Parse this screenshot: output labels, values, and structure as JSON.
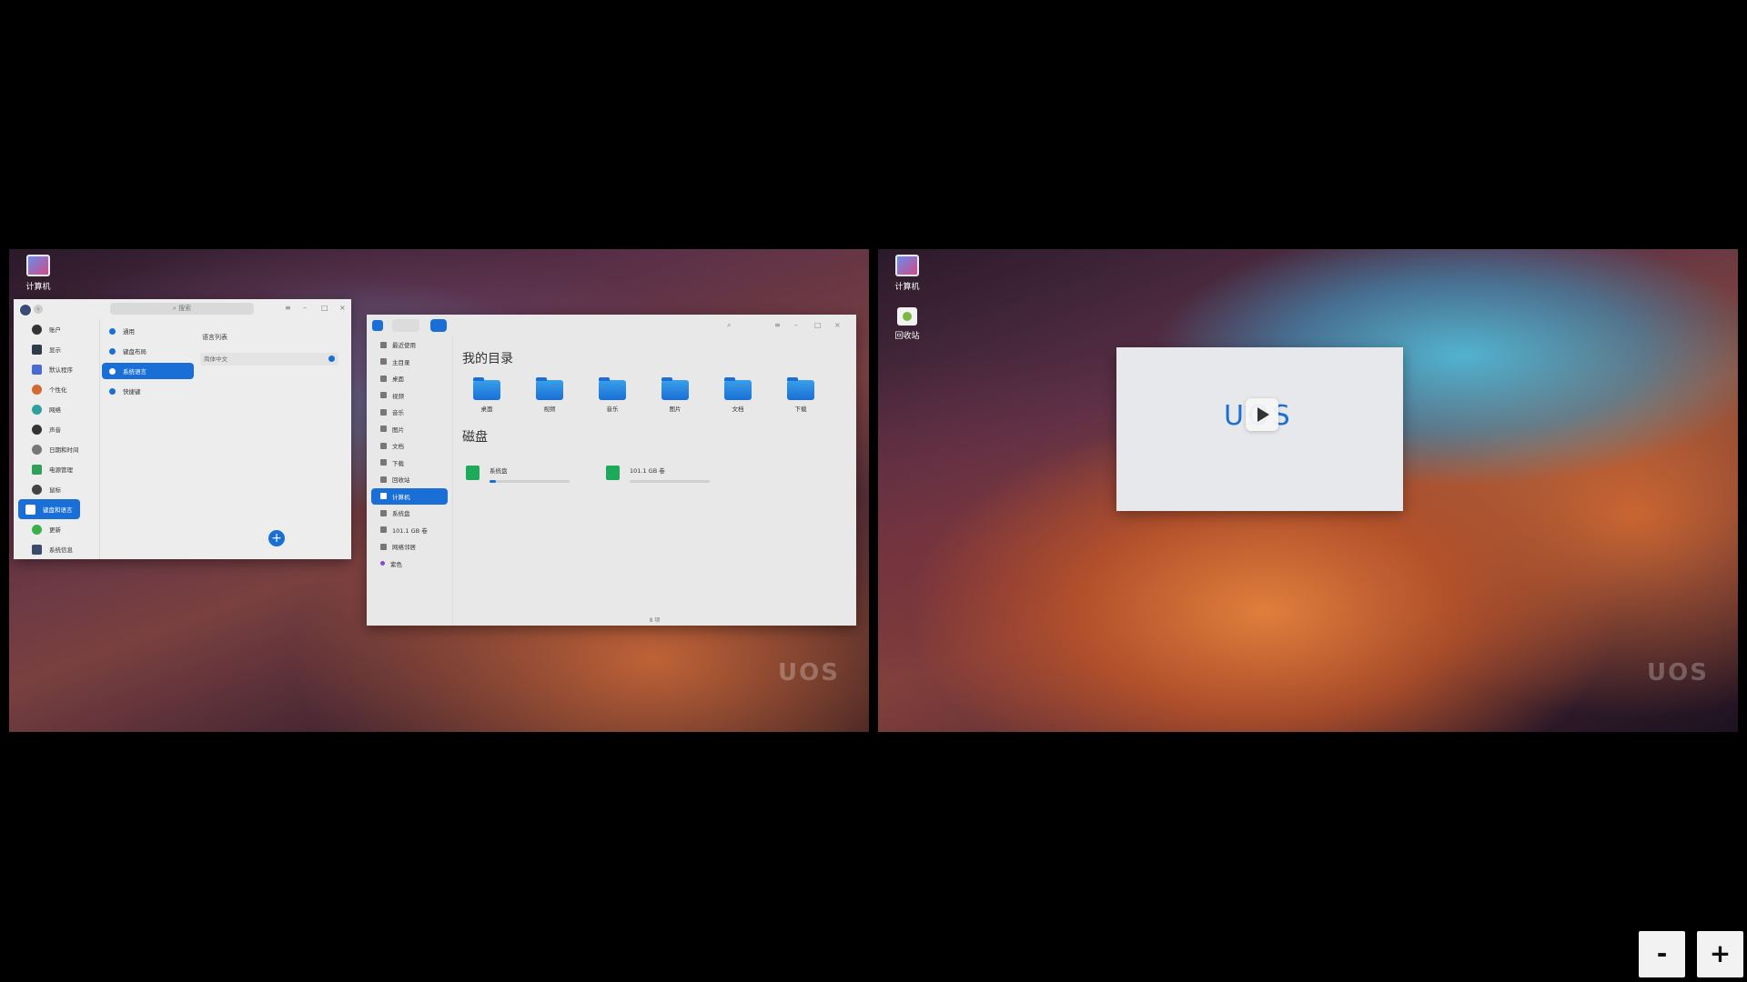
{
  "left_desktop": {
    "icons": [
      {
        "label": "计算机",
        "icon": "computer-icon"
      }
    ],
    "watermark": "UOS"
  },
  "settings_window": {
    "search_placeholder": "搜索",
    "sidebar": [
      {
        "label": "账户",
        "color": "#333333"
      },
      {
        "label": "显示",
        "color": "#2e3b4a"
      },
      {
        "label": "默认程序",
        "color": "#4a6ad0"
      },
      {
        "label": "个性化",
        "color": "#d06a2e"
      },
      {
        "label": "网络",
        "color": "#2ea0a0"
      },
      {
        "label": "声音",
        "color": "#333333"
      },
      {
        "label": "日期和时间",
        "color": "#555555"
      },
      {
        "label": "电源管理",
        "color": "#2ea05a"
      },
      {
        "label": "鼠标",
        "color": "#444444"
      },
      {
        "label": "键盘和语言",
        "color": "#ffffff"
      },
      {
        "label": "更新",
        "color": "#3ab04a"
      },
      {
        "label": "系统信息",
        "color": "#3a4a6a"
      }
    ],
    "middle": [
      {
        "label": "通用"
      },
      {
        "label": "键盘布局"
      },
      {
        "label": "系统语言"
      },
      {
        "label": "快捷键"
      }
    ],
    "right_title": "语言列表",
    "language_row": "简体中文",
    "add_label": "+"
  },
  "file_manager": {
    "sidebar": [
      {
        "label": "最近使用"
      },
      {
        "label": "主目录"
      },
      {
        "label": "桌面"
      },
      {
        "label": "视频"
      },
      {
        "label": "音乐"
      },
      {
        "label": "图片"
      },
      {
        "label": "文档"
      },
      {
        "label": "下载"
      },
      {
        "label": "回收站"
      },
      {
        "label": "计算机"
      },
      {
        "label": "系统盘"
      },
      {
        "label": "101.1 GB 卷"
      },
      {
        "label": "网络邻居"
      },
      {
        "label": "紫色"
      }
    ],
    "my_dirs_title": "我的目录",
    "folders": [
      {
        "label": "桌面"
      },
      {
        "label": "视频"
      },
      {
        "label": "音乐"
      },
      {
        "label": "图片"
      },
      {
        "label": "文档"
      },
      {
        "label": "下载"
      }
    ],
    "disks_title": "磁盘",
    "disks": [
      {
        "label": "系统盘",
        "usage": 0.08
      },
      {
        "label": "101.1 GB 卷",
        "usage": 0.0
      }
    ],
    "status": "8 项"
  },
  "right_desktop": {
    "icons": [
      {
        "label": "计算机",
        "icon": "computer-icon"
      },
      {
        "label": "回收站",
        "icon": "trash-icon"
      }
    ],
    "watermark": "UOS",
    "splash_logo": "UOS"
  },
  "zoom": {
    "minus": "-",
    "plus": "+"
  }
}
